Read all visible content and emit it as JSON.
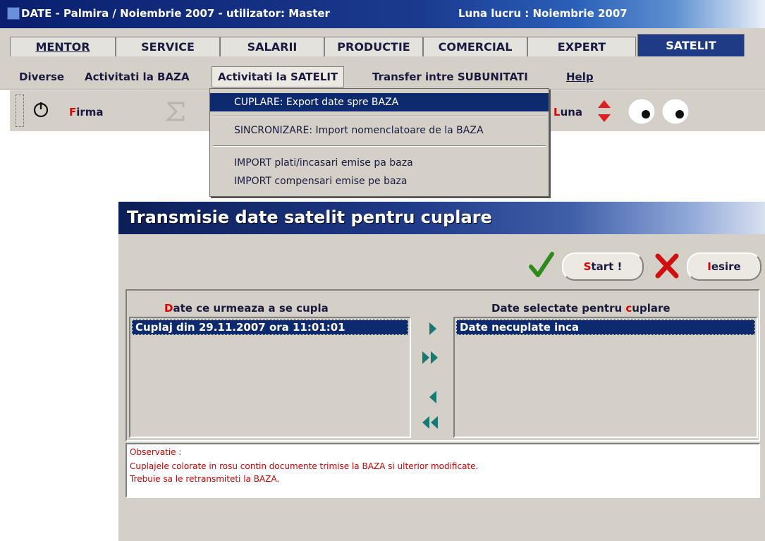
{
  "window": {
    "title": "DATE - Palmira / Noiembrie 2007 - utilizator: Master",
    "luna_lucru": "Luna lucru : Noiembrie 2007"
  },
  "tabs": [
    {
      "label": "MENTOR",
      "active": false
    },
    {
      "label": "SERVICE",
      "active": false
    },
    {
      "label": "SALARII",
      "active": false
    },
    {
      "label": "PRODUCTIE",
      "active": false
    },
    {
      "label": "COMERCIAL",
      "active": false
    },
    {
      "label": "EXPERT",
      "active": false
    },
    {
      "label": "SATELIT",
      "active": true
    }
  ],
  "menubar": {
    "items": [
      "Diverse",
      "Activitati la BAZA",
      "Activitati la SATELIT",
      "Transfer intre SUBUNITATI",
      "Help"
    ]
  },
  "toolbar": {
    "firma_first": "F",
    "firma_rest": "irma",
    "luna_first": "L",
    "luna_rest": "una"
  },
  "dropdown": {
    "items": [
      "CUPLARE: Export date spre BAZA",
      "SINCRONIZARE: Import nomenclatoare de la BAZA",
      "IMPORT plati/incasari emise pa baza",
      "IMPORT compensari emise pe baza"
    ]
  },
  "dialog": {
    "title": "Transmisie date satelit pentru cuplare",
    "start_first": "S",
    "start_rest": "tart !",
    "iesire_first": "I",
    "iesire_rest": "esire",
    "left_header_first": "D",
    "left_header_rest": "ate ce urmeaza a se cupla",
    "right_header_pre": "Date selectate pentru ",
    "right_header_c": "c",
    "right_header_rest": "uplare",
    "left_items": [
      "Cuplaj din 29.11.2007 ora 11:01:01"
    ],
    "right_items": [
      "Date necuplate inca"
    ],
    "observatie": [
      "Observatie :",
      "Cuplajele colorate in rosu contin documente trimise la BAZA si ulterior modificate.",
      "Trebuie sa le retransmiteti la BAZA."
    ]
  },
  "colors": {
    "accent_red": "#e00000",
    "selection_blue": "#0e2a6e",
    "arrow_teal": "#157a73"
  }
}
